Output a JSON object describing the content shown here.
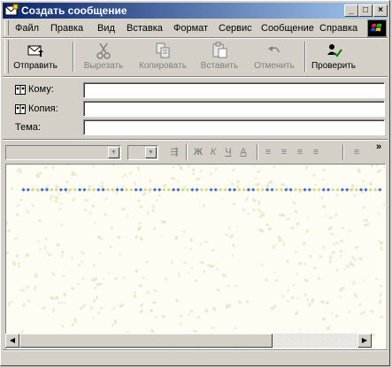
{
  "window": {
    "title": "Создать сообщение",
    "minimize_label": "_",
    "maximize_label": "□",
    "close_label": "×"
  },
  "menu": {
    "items": [
      {
        "label": "Файл"
      },
      {
        "label": "Правка"
      },
      {
        "label": "Вид"
      },
      {
        "label": "Вставка"
      },
      {
        "label": "Формат"
      },
      {
        "label": "Сервис"
      },
      {
        "label": "Сообщение"
      },
      {
        "label": "Справка"
      }
    ]
  },
  "toolbar": {
    "send": {
      "label": "Отправить",
      "icon": "send-icon"
    },
    "cut": {
      "label": "Вырезать",
      "icon": "scissors-icon"
    },
    "copy": {
      "label": "Копировать",
      "icon": "copy-icon"
    },
    "paste": {
      "label": "Вставить",
      "icon": "paste-icon"
    },
    "undo": {
      "label": "Отменить",
      "icon": "undo-icon"
    },
    "check": {
      "label": "Проверить",
      "icon": "spellcheck-icon"
    }
  },
  "header_fields": {
    "to_label": "Кому:",
    "to_value": "",
    "cc_label": "Копия:",
    "cc_value": "",
    "subject_label": "Тема:",
    "subject_value": ""
  },
  "format_toolbar": {
    "font_name": "",
    "font_size": "",
    "buttons": [
      {
        "icon": "paragraph-style-icon",
        "label": "⇶"
      },
      {
        "icon": "bold-icon",
        "label": "Ж"
      },
      {
        "icon": "italic-icon",
        "label": "К"
      },
      {
        "icon": "underline-icon",
        "label": "Ч"
      },
      {
        "icon": "font-color-icon",
        "label": "A"
      },
      {
        "icon": "numbered-list-icon",
        "label": "≡"
      },
      {
        "icon": "bulleted-list-icon",
        "label": "≡"
      },
      {
        "icon": "decrease-indent-icon",
        "label": "≡"
      },
      {
        "icon": "increase-indent-icon",
        "label": "≡"
      },
      {
        "icon": "align-left-icon",
        "label": "≡"
      },
      {
        "icon": "more-icon",
        "label": "»"
      }
    ]
  },
  "message_body": {
    "text": ""
  },
  "colors": {
    "title_gradient_start": "#0a246a",
    "title_gradient_end": "#a6caf0",
    "face": "#d4d0c8",
    "stationery_background": "#fefdf4",
    "stationery_pattern": "#e6e4c4",
    "border_dots_blue": "#3f6fd0",
    "border_dots_yellow": "#d6d68a"
  }
}
